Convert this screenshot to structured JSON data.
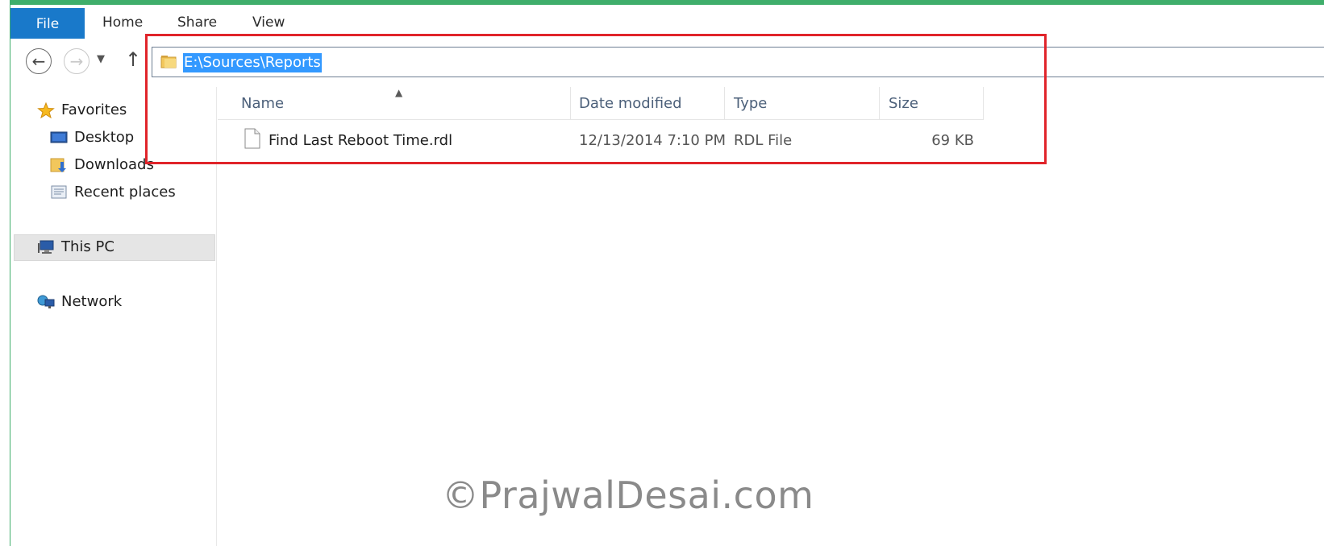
{
  "ribbon": {
    "tabs": [
      "File",
      "Home",
      "Share",
      "View"
    ]
  },
  "address_bar": {
    "path": "E:\\Sources\\Reports"
  },
  "sidebar": {
    "favorites": "Favorites",
    "desktop": "Desktop",
    "downloads": "Downloads",
    "recent": "Recent places",
    "thispc": "This PC",
    "network": "Network"
  },
  "columns": {
    "name": "Name",
    "date": "Date modified",
    "type": "Type",
    "size": "Size"
  },
  "files": [
    {
      "name": "Find Last Reboot Time.rdl",
      "date": "12/13/2014 7:10 PM",
      "type": "RDL File",
      "size": "69 KB"
    }
  ],
  "watermark": "©PrajwalDesai.com",
  "colors": {
    "file_tab": "#1979ca",
    "selection": "#3399ff",
    "highlight_box": "#e0242a",
    "window_frame": "#3fae6b"
  }
}
